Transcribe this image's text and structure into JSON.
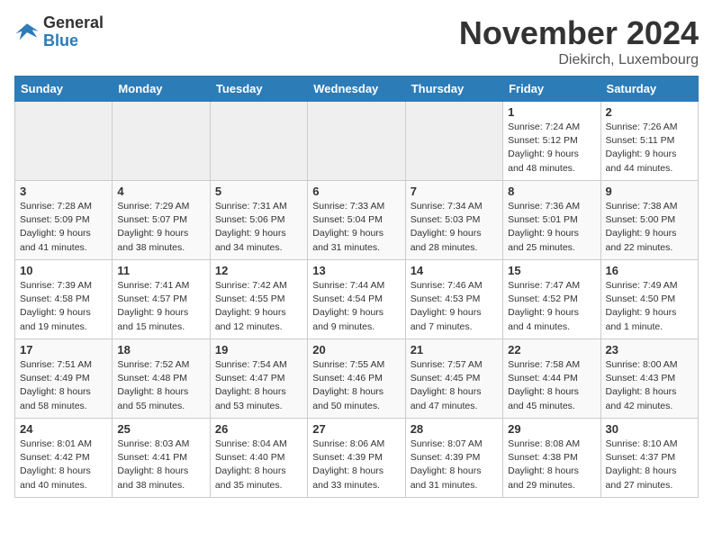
{
  "logo": {
    "general": "General",
    "blue": "Blue"
  },
  "title": "November 2024",
  "location": "Diekirch, Luxembourg",
  "days_of_week": [
    "Sunday",
    "Monday",
    "Tuesday",
    "Wednesday",
    "Thursday",
    "Friday",
    "Saturday"
  ],
  "weeks": [
    [
      {
        "day": "",
        "sunrise": "",
        "sunset": "",
        "daylight": "",
        "empty": true
      },
      {
        "day": "",
        "sunrise": "",
        "sunset": "",
        "daylight": "",
        "empty": true
      },
      {
        "day": "",
        "sunrise": "",
        "sunset": "",
        "daylight": "",
        "empty": true
      },
      {
        "day": "",
        "sunrise": "",
        "sunset": "",
        "daylight": "",
        "empty": true
      },
      {
        "day": "",
        "sunrise": "",
        "sunset": "",
        "daylight": "",
        "empty": true
      },
      {
        "day": "1",
        "sunrise": "Sunrise: 7:24 AM",
        "sunset": "Sunset: 5:12 PM",
        "daylight": "Daylight: 9 hours and 48 minutes.",
        "empty": false
      },
      {
        "day": "2",
        "sunrise": "Sunrise: 7:26 AM",
        "sunset": "Sunset: 5:11 PM",
        "daylight": "Daylight: 9 hours and 44 minutes.",
        "empty": false
      }
    ],
    [
      {
        "day": "3",
        "sunrise": "Sunrise: 7:28 AM",
        "sunset": "Sunset: 5:09 PM",
        "daylight": "Daylight: 9 hours and 41 minutes.",
        "empty": false
      },
      {
        "day": "4",
        "sunrise": "Sunrise: 7:29 AM",
        "sunset": "Sunset: 5:07 PM",
        "daylight": "Daylight: 9 hours and 38 minutes.",
        "empty": false
      },
      {
        "day": "5",
        "sunrise": "Sunrise: 7:31 AM",
        "sunset": "Sunset: 5:06 PM",
        "daylight": "Daylight: 9 hours and 34 minutes.",
        "empty": false
      },
      {
        "day": "6",
        "sunrise": "Sunrise: 7:33 AM",
        "sunset": "Sunset: 5:04 PM",
        "daylight": "Daylight: 9 hours and 31 minutes.",
        "empty": false
      },
      {
        "day": "7",
        "sunrise": "Sunrise: 7:34 AM",
        "sunset": "Sunset: 5:03 PM",
        "daylight": "Daylight: 9 hours and 28 minutes.",
        "empty": false
      },
      {
        "day": "8",
        "sunrise": "Sunrise: 7:36 AM",
        "sunset": "Sunset: 5:01 PM",
        "daylight": "Daylight: 9 hours and 25 minutes.",
        "empty": false
      },
      {
        "day": "9",
        "sunrise": "Sunrise: 7:38 AM",
        "sunset": "Sunset: 5:00 PM",
        "daylight": "Daylight: 9 hours and 22 minutes.",
        "empty": false
      }
    ],
    [
      {
        "day": "10",
        "sunrise": "Sunrise: 7:39 AM",
        "sunset": "Sunset: 4:58 PM",
        "daylight": "Daylight: 9 hours and 19 minutes.",
        "empty": false
      },
      {
        "day": "11",
        "sunrise": "Sunrise: 7:41 AM",
        "sunset": "Sunset: 4:57 PM",
        "daylight": "Daylight: 9 hours and 15 minutes.",
        "empty": false
      },
      {
        "day": "12",
        "sunrise": "Sunrise: 7:42 AM",
        "sunset": "Sunset: 4:55 PM",
        "daylight": "Daylight: 9 hours and 12 minutes.",
        "empty": false
      },
      {
        "day": "13",
        "sunrise": "Sunrise: 7:44 AM",
        "sunset": "Sunset: 4:54 PM",
        "daylight": "Daylight: 9 hours and 9 minutes.",
        "empty": false
      },
      {
        "day": "14",
        "sunrise": "Sunrise: 7:46 AM",
        "sunset": "Sunset: 4:53 PM",
        "daylight": "Daylight: 9 hours and 7 minutes.",
        "empty": false
      },
      {
        "day": "15",
        "sunrise": "Sunrise: 7:47 AM",
        "sunset": "Sunset: 4:52 PM",
        "daylight": "Daylight: 9 hours and 4 minutes.",
        "empty": false
      },
      {
        "day": "16",
        "sunrise": "Sunrise: 7:49 AM",
        "sunset": "Sunset: 4:50 PM",
        "daylight": "Daylight: 9 hours and 1 minute.",
        "empty": false
      }
    ],
    [
      {
        "day": "17",
        "sunrise": "Sunrise: 7:51 AM",
        "sunset": "Sunset: 4:49 PM",
        "daylight": "Daylight: 8 hours and 58 minutes.",
        "empty": false
      },
      {
        "day": "18",
        "sunrise": "Sunrise: 7:52 AM",
        "sunset": "Sunset: 4:48 PM",
        "daylight": "Daylight: 8 hours and 55 minutes.",
        "empty": false
      },
      {
        "day": "19",
        "sunrise": "Sunrise: 7:54 AM",
        "sunset": "Sunset: 4:47 PM",
        "daylight": "Daylight: 8 hours and 53 minutes.",
        "empty": false
      },
      {
        "day": "20",
        "sunrise": "Sunrise: 7:55 AM",
        "sunset": "Sunset: 4:46 PM",
        "daylight": "Daylight: 8 hours and 50 minutes.",
        "empty": false
      },
      {
        "day": "21",
        "sunrise": "Sunrise: 7:57 AM",
        "sunset": "Sunset: 4:45 PM",
        "daylight": "Daylight: 8 hours and 47 minutes.",
        "empty": false
      },
      {
        "day": "22",
        "sunrise": "Sunrise: 7:58 AM",
        "sunset": "Sunset: 4:44 PM",
        "daylight": "Daylight: 8 hours and 45 minutes.",
        "empty": false
      },
      {
        "day": "23",
        "sunrise": "Sunrise: 8:00 AM",
        "sunset": "Sunset: 4:43 PM",
        "daylight": "Daylight: 8 hours and 42 minutes.",
        "empty": false
      }
    ],
    [
      {
        "day": "24",
        "sunrise": "Sunrise: 8:01 AM",
        "sunset": "Sunset: 4:42 PM",
        "daylight": "Daylight: 8 hours and 40 minutes.",
        "empty": false
      },
      {
        "day": "25",
        "sunrise": "Sunrise: 8:03 AM",
        "sunset": "Sunset: 4:41 PM",
        "daylight": "Daylight: 8 hours and 38 minutes.",
        "empty": false
      },
      {
        "day": "26",
        "sunrise": "Sunrise: 8:04 AM",
        "sunset": "Sunset: 4:40 PM",
        "daylight": "Daylight: 8 hours and 35 minutes.",
        "empty": false
      },
      {
        "day": "27",
        "sunrise": "Sunrise: 8:06 AM",
        "sunset": "Sunset: 4:39 PM",
        "daylight": "Daylight: 8 hours and 33 minutes.",
        "empty": false
      },
      {
        "day": "28",
        "sunrise": "Sunrise: 8:07 AM",
        "sunset": "Sunset: 4:39 PM",
        "daylight": "Daylight: 8 hours and 31 minutes.",
        "empty": false
      },
      {
        "day": "29",
        "sunrise": "Sunrise: 8:08 AM",
        "sunset": "Sunset: 4:38 PM",
        "daylight": "Daylight: 8 hours and 29 minutes.",
        "empty": false
      },
      {
        "day": "30",
        "sunrise": "Sunrise: 8:10 AM",
        "sunset": "Sunset: 4:37 PM",
        "daylight": "Daylight: 8 hours and 27 minutes.",
        "empty": false
      }
    ]
  ]
}
